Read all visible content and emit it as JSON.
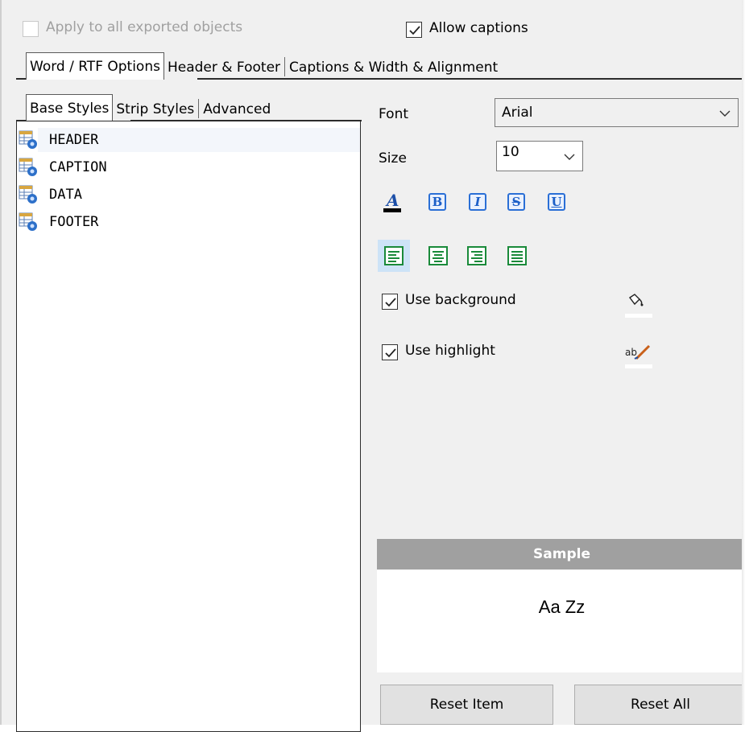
{
  "top": {
    "apply_all": {
      "label": "Apply to all exported objects",
      "checked": false,
      "enabled": false
    },
    "allow_captions": {
      "label": "Allow captions",
      "checked": true
    }
  },
  "main_tabs": [
    "Word / RTF Options",
    "Header & Footer",
    "Captions & Width & Alignment"
  ],
  "main_tabs_active": 0,
  "sub_tabs": [
    "Base Styles",
    "Strip Styles",
    "Advanced"
  ],
  "sub_tabs_active": 0,
  "tree": {
    "items": [
      {
        "label": "HEADER",
        "icon": "style-table-icon",
        "selected": true
      },
      {
        "label": "CAPTION",
        "icon": "style-table-icon",
        "selected": false
      },
      {
        "label": "DATA",
        "icon": "style-table-icon",
        "selected": false
      },
      {
        "label": "FOOTER",
        "icon": "style-table-icon",
        "selected": false
      }
    ]
  },
  "font": {
    "label": "Font",
    "value": "Arial"
  },
  "size": {
    "label": "Size",
    "value": "10"
  },
  "format_buttons": {
    "font_color": "font-color-icon",
    "bold": "B",
    "italic": "I",
    "strikeout": "S",
    "underline": "U"
  },
  "alignment": {
    "options": [
      "align-left-icon",
      "align-center-icon",
      "align-right-icon",
      "align-justify-icon"
    ],
    "active": 0
  },
  "use_background": {
    "label": "Use background",
    "checked": true,
    "icon": "fill-color-icon"
  },
  "use_highlight": {
    "label": "Use highlight",
    "checked": true,
    "icon": "highlight-color-icon"
  },
  "sample": {
    "header": "Sample",
    "text": "Aa Zz"
  },
  "buttons": {
    "reset_item": "Reset Item",
    "reset_all": "Reset All"
  },
  "colors": {
    "accent": "#2a6fd6",
    "align_green": "#1a8a3a",
    "sample_header": "#a0a0a0"
  }
}
